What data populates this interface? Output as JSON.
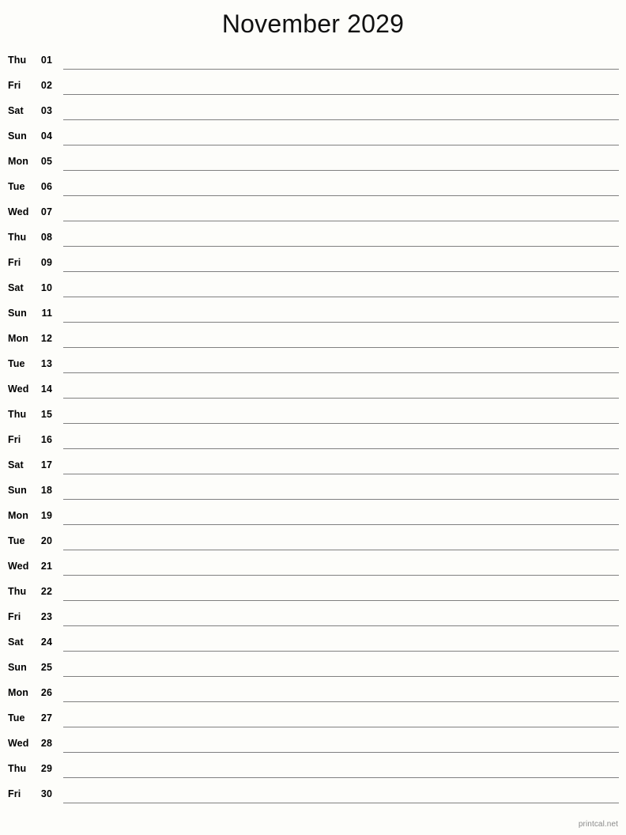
{
  "page": {
    "title": "November 2029",
    "background_color": "#fdfdfa",
    "rule_color": "#808080",
    "text_color": "#000000"
  },
  "calendar": {
    "month": "November",
    "year": "2029",
    "days": [
      {
        "weekday": "Thu",
        "date": "01"
      },
      {
        "weekday": "Fri",
        "date": "02"
      },
      {
        "weekday": "Sat",
        "date": "03"
      },
      {
        "weekday": "Sun",
        "date": "04"
      },
      {
        "weekday": "Mon",
        "date": "05"
      },
      {
        "weekday": "Tue",
        "date": "06"
      },
      {
        "weekday": "Wed",
        "date": "07"
      },
      {
        "weekday": "Thu",
        "date": "08"
      },
      {
        "weekday": "Fri",
        "date": "09"
      },
      {
        "weekday": "Sat",
        "date": "10"
      },
      {
        "weekday": "Sun",
        "date": "11"
      },
      {
        "weekday": "Mon",
        "date": "12"
      },
      {
        "weekday": "Tue",
        "date": "13"
      },
      {
        "weekday": "Wed",
        "date": "14"
      },
      {
        "weekday": "Thu",
        "date": "15"
      },
      {
        "weekday": "Fri",
        "date": "16"
      },
      {
        "weekday": "Sat",
        "date": "17"
      },
      {
        "weekday": "Sun",
        "date": "18"
      },
      {
        "weekday": "Mon",
        "date": "19"
      },
      {
        "weekday": "Tue",
        "date": "20"
      },
      {
        "weekday": "Wed",
        "date": "21"
      },
      {
        "weekday": "Thu",
        "date": "22"
      },
      {
        "weekday": "Fri",
        "date": "23"
      },
      {
        "weekday": "Sat",
        "date": "24"
      },
      {
        "weekday": "Sun",
        "date": "25"
      },
      {
        "weekday": "Mon",
        "date": "26"
      },
      {
        "weekday": "Tue",
        "date": "27"
      },
      {
        "weekday": "Wed",
        "date": "28"
      },
      {
        "weekday": "Thu",
        "date": "29"
      },
      {
        "weekday": "Fri",
        "date": "30"
      }
    ]
  },
  "footer": {
    "credit": "printcal.net"
  }
}
